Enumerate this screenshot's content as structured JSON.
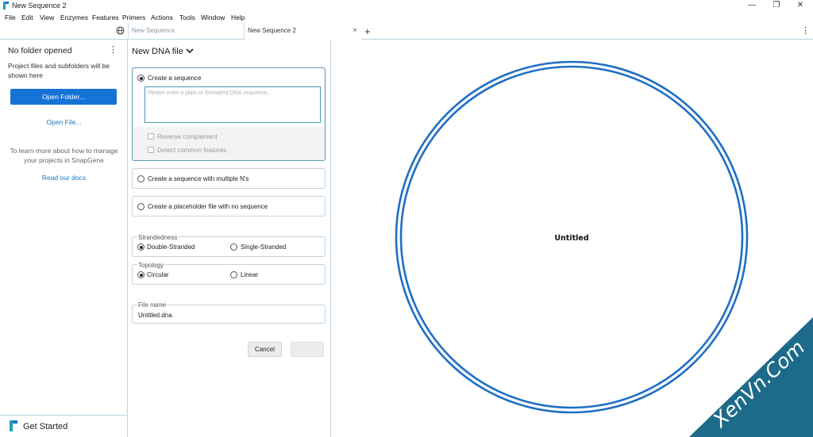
{
  "window": {
    "title": "New Sequence 2",
    "controls": {
      "minimize": "—",
      "restore": "❐",
      "close": "✕"
    }
  },
  "menu": [
    "File",
    "Edit",
    "View",
    "Enzymes",
    "Features",
    "Primers",
    "Actions",
    "Tools",
    "Window",
    "Help"
  ],
  "tabs": [
    {
      "label": "New Sequence",
      "active": false
    },
    {
      "label": "New Sequence 2",
      "active": true,
      "close": "×"
    }
  ],
  "tab_add": "+",
  "tab_menu": "⋮",
  "sidebar": {
    "title": "No folder opened",
    "kebab": "⋮",
    "description": "Project files and subfolders will be shown here",
    "open_folder_label": "Open Folder...",
    "open_file_label": "Open File...",
    "learn_text": "To learn more about how to manage your projects in SnapGene",
    "docs_link": "Read our docs",
    "get_started": "Get Started"
  },
  "new_file": {
    "header": "New DNA file",
    "options": {
      "create_sequence": "Create a sequence",
      "sequence_placeholder": "Please enter a plain or formatted DNA sequence...",
      "reverse_complement": "Reverse complement",
      "detect_features": "Detect common features",
      "multiple_ns": "Create a sequence with multiple N's",
      "placeholder_file": "Create a placeholder file with no sequence"
    },
    "selected_option": "create_sequence",
    "strandedness": {
      "label": "Strandedness",
      "double": "Double-Stranded",
      "single": "Single-Stranded",
      "selected": "double"
    },
    "topology": {
      "label": "Topology",
      "circular": "Circular",
      "linear": "Linear",
      "selected": "circular"
    },
    "file_name": {
      "label": "File name",
      "value": "Untitled.dna"
    },
    "cancel_label": "Cancel",
    "create_label": "Create"
  },
  "map": {
    "name": "Untitled",
    "ring_color": "#1f6fc4"
  },
  "watermark": {
    "text": "XenVn.Com",
    "color": "#1d6a8a"
  },
  "colors": {
    "accent": "#1673d6",
    "link": "#1a78c2",
    "border": "#bcd3e3"
  }
}
